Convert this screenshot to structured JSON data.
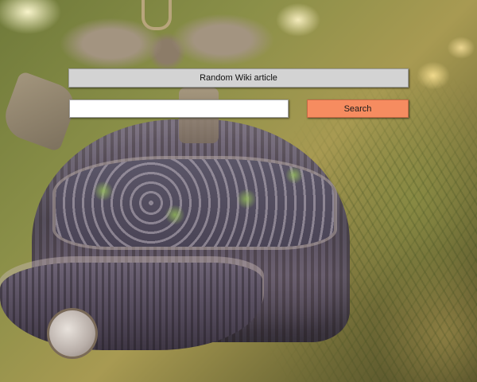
{
  "header": {
    "title": "Random Wiki article"
  },
  "search": {
    "value": "",
    "placeholder": "",
    "button_label": "Search"
  },
  "background": {
    "subject": "christmas-bell-ornament-photo"
  },
  "colors": {
    "search_button": "#f68c60",
    "title_bar": "#d3d3d3",
    "input_background": "#ffffff"
  }
}
